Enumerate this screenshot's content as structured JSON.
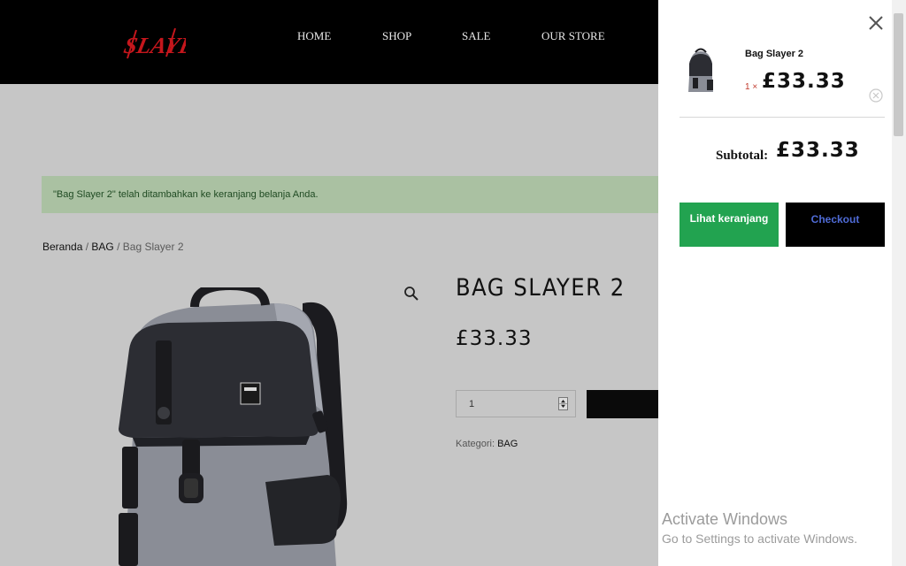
{
  "header": {
    "logo_text": "SLAYER",
    "nav": [
      {
        "label": "HOME"
      },
      {
        "label": "SHOP"
      },
      {
        "label": "SALE"
      },
      {
        "label": "OUR STORE"
      }
    ]
  },
  "notice": {
    "text": "\"Bag Slayer 2\" telah ditambahkan ke keranjang belanja Anda."
  },
  "breadcrumb": {
    "home": "Beranda",
    "sep1": "/",
    "category": "BAG",
    "sep2": "/",
    "current": "Bag Slayer 2"
  },
  "product": {
    "title": "BAG SLAYER 2",
    "price": "£33.33",
    "quantity": "1",
    "category_label": "Kategori:",
    "category_value": "BAG"
  },
  "side_cart": {
    "item_name": "Bag Slayer 2",
    "item_qty": "1 ×",
    "item_price": "£33.33",
    "subtotal_label": "Subtotal:",
    "subtotal_value": "£33.33",
    "view_cart_label": "Lihat keranjang",
    "checkout_label": "Checkout"
  },
  "watermark": {
    "title": "Activate Windows",
    "subtitle": "Go to Settings to activate Windows."
  },
  "colors": {
    "header_bg": "#000000",
    "logo_red": "#c4161c",
    "notice_bg": "#aac1a2",
    "view_cart_bg": "#22a350",
    "checkout_bg": "#000000",
    "checkout_text": "#4f6bd6",
    "qty_red": "#c0392b"
  }
}
